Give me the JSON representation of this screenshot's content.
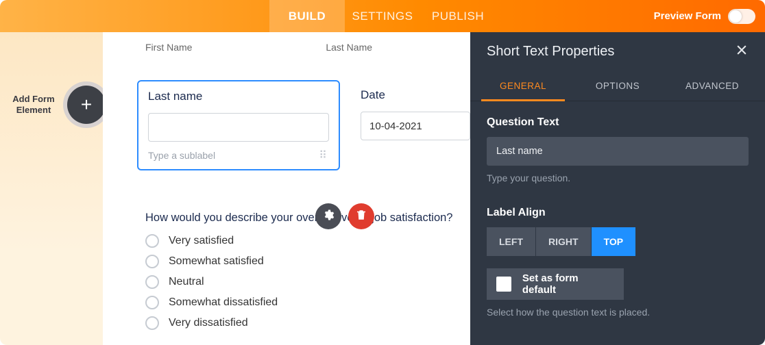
{
  "header": {
    "tabs": {
      "build": "BUILD",
      "settings": "SETTINGS",
      "publish": "PUBLISH"
    },
    "preview_label": "Preview Form"
  },
  "left_rail": {
    "add_element": "Add Form Element"
  },
  "canvas": {
    "name_row": {
      "first_label": "First Name",
      "last_label": "Last Name"
    },
    "selected": {
      "label": "Last name",
      "sublabel_placeholder": "Type a sublabel"
    },
    "date": {
      "label": "Date",
      "value": "10-04-2021"
    },
    "question": {
      "text": "How would you describe your overall level of job satisfaction?",
      "options": [
        "Very satisfied",
        "Somewhat satisfied",
        "Neutral",
        "Somewhat dissatisfied",
        "Very dissatisfied"
      ]
    }
  },
  "props": {
    "title": "Short Text Properties",
    "tabs": {
      "general": "GENERAL",
      "options": "OPTIONS",
      "advanced": "ADVANCED"
    },
    "question_text": {
      "label": "Question Text",
      "value": "Last name",
      "hint": "Type your question."
    },
    "label_align": {
      "label": "Label Align",
      "options": {
        "left": "LEFT",
        "right": "RIGHT",
        "top": "TOP"
      },
      "default_label": "Set as form default",
      "hint": "Select how the question text is placed."
    }
  }
}
